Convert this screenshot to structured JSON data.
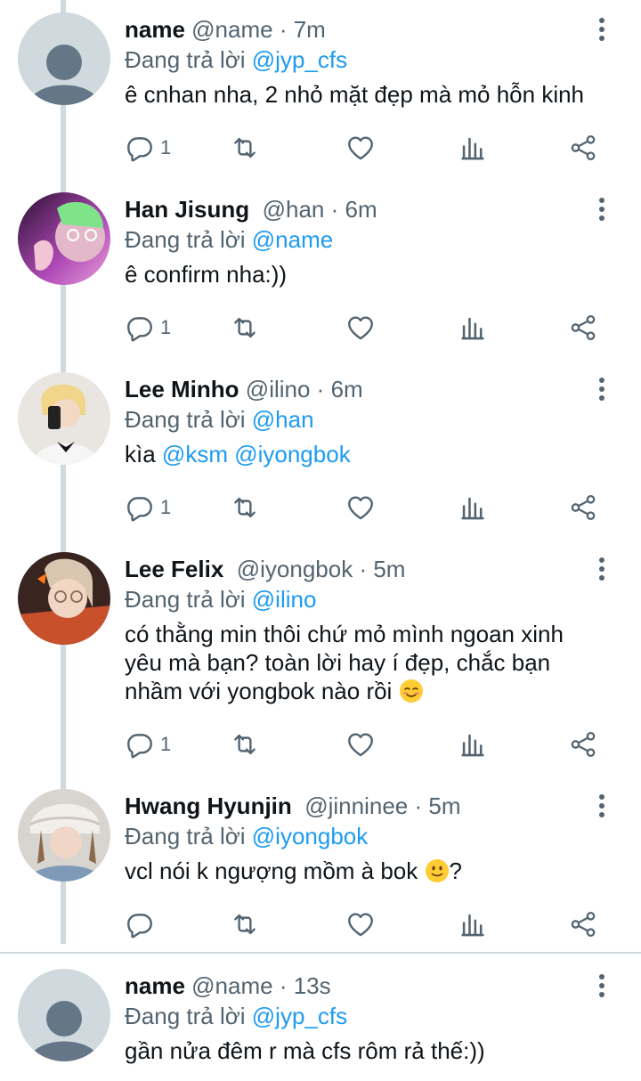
{
  "tweets": [
    {
      "name": "name",
      "handle": "@name",
      "time": "7m",
      "replying_prefix": "Đang trả lời ",
      "replying_to": "@jyp_cfs",
      "text": "ê cnhan nha, 2 nhỏ mặt đẹp mà mỏ hỗn kinh",
      "reply_count": "1"
    },
    {
      "name": "Han Jisung",
      "handle": "@han",
      "time": "6m",
      "replying_prefix": "Đang trả lời ",
      "replying_to": "@name",
      "text": "ê confirm nha:))",
      "reply_count": "1"
    },
    {
      "name": "Lee Minho",
      "handle": "@ilino",
      "time": "6m",
      "replying_prefix": "Đang trả lời ",
      "replying_to": "@han",
      "text_prefix": "kìa ",
      "mention1": "@ksm",
      "mention2": "@iyongbok",
      "reply_count": "1"
    },
    {
      "name": "Lee Felix",
      "handle": "@iyongbok",
      "time": "5m",
      "replying_prefix": "Đang trả lời ",
      "replying_to": "@ilino",
      "text_line1": "có thằng min thôi chứ mỏ mình ngoan xinh",
      "text_line2": "yêu mà bạn? toàn lời hay í đẹp, chắc bạn",
      "text_line3": "nhầm với yongbok nào rồi",
      "reply_count": "1"
    },
    {
      "name": "Hwang Hyunjin",
      "handle": "@jinninee",
      "time": "5m",
      "replying_prefix": "Đang trả lời ",
      "replying_to": "@iyongbok",
      "text": "vcl nói k ngượng mồm à bok",
      "text_suffix": "?",
      "reply_count": ""
    },
    {
      "name": "name",
      "handle": "@name",
      "time": "13s",
      "replying_prefix": "Đang trả lời ",
      "replying_to": "@jyp_cfs",
      "text": "gần nửa đêm r mà cfs rôm rả thế:))"
    }
  ],
  "separator": " · ",
  "icons": {
    "reply": "reply-icon",
    "retweet": "retweet-icon",
    "like": "heart-icon",
    "views": "views-icon",
    "share": "share-icon",
    "more": "more-icon"
  },
  "colors": {
    "accent": "#1d9bf0",
    "secondary_text": "#536471",
    "thread_line": "#cfd9de"
  }
}
